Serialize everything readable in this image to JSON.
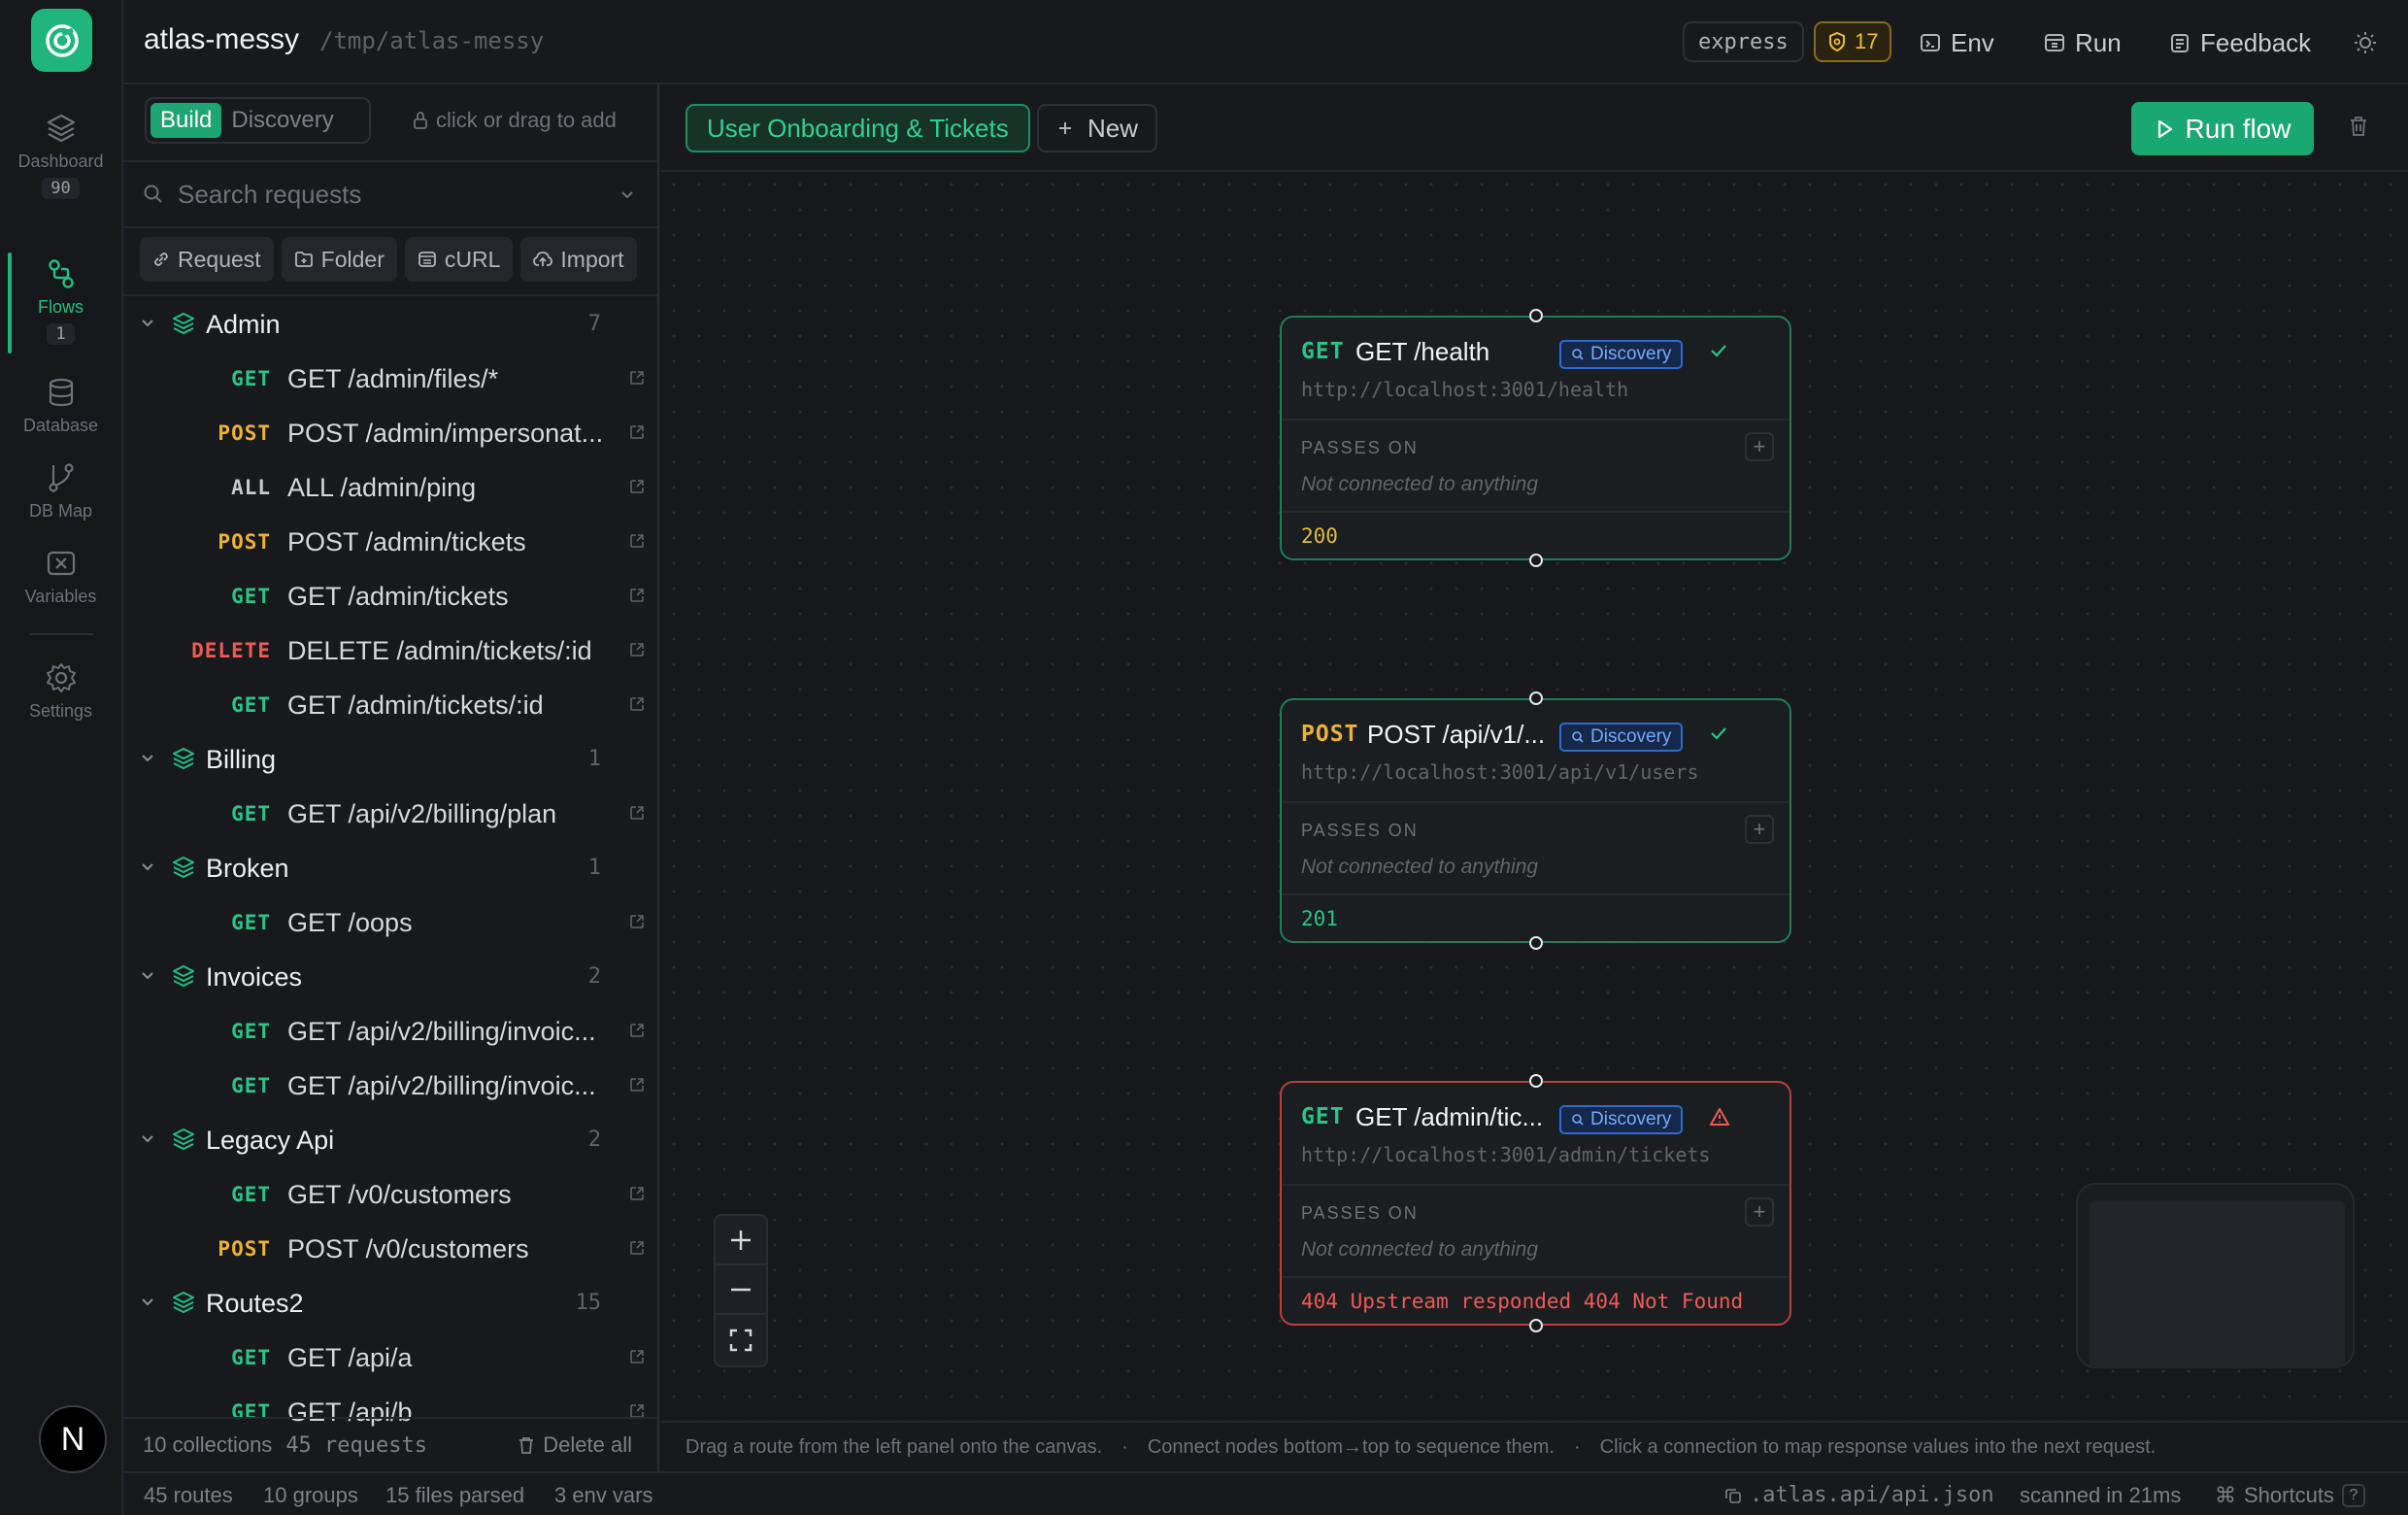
{
  "app": {
    "name": "atlas-messy",
    "path": "/tmp/atlas-messy",
    "framework": "express",
    "warning_count": "17",
    "env_label": "Env",
    "run_label": "Run",
    "feedback_label": "Feedback",
    "avatar_letter": "N",
    "accent": "#1fb57c"
  },
  "rail": {
    "items": [
      {
        "label": "Dashboard",
        "count": "90",
        "icon": "layers-icon"
      },
      {
        "label": "Flows",
        "count": "1",
        "icon": "flow-icon"
      },
      {
        "label": "Database",
        "icon": "database-icon"
      },
      {
        "label": "DB Map",
        "icon": "branch-icon"
      },
      {
        "label": "Variables",
        "icon": "variables-icon"
      },
      {
        "label": "Settings",
        "icon": "gear-icon"
      }
    ]
  },
  "sidebar": {
    "mode_build": "Build",
    "mode_discovery": "Discovery",
    "hint": "click or drag to add",
    "search_placeholder": "Search requests",
    "actions": {
      "request": "Request",
      "folder": "Folder",
      "curl": "cURL",
      "import": "Import"
    },
    "groups": [
      {
        "name": "Admin",
        "count": "7",
        "requests": [
          {
            "method": "GET",
            "name": "GET /admin/files/*"
          },
          {
            "method": "POST",
            "name": "POST /admin/impersonat..."
          },
          {
            "method": "ALL",
            "name": "ALL /admin/ping"
          },
          {
            "method": "POST",
            "name": "POST /admin/tickets"
          },
          {
            "method": "GET",
            "name": "GET /admin/tickets"
          },
          {
            "method": "DELETE",
            "name": "DELETE /admin/tickets/:id"
          },
          {
            "method": "GET",
            "name": "GET /admin/tickets/:id"
          }
        ]
      },
      {
        "name": "Billing",
        "count": "1",
        "requests": [
          {
            "method": "GET",
            "name": "GET /api/v2/billing/plan"
          }
        ]
      },
      {
        "name": "Broken",
        "count": "1",
        "requests": [
          {
            "method": "GET",
            "name": "GET /oops"
          }
        ]
      },
      {
        "name": "Invoices",
        "count": "2",
        "requests": [
          {
            "method": "GET",
            "name": "GET /api/v2/billing/invoic..."
          },
          {
            "method": "GET",
            "name": "GET /api/v2/billing/invoic..."
          }
        ]
      },
      {
        "name": "Legacy Api",
        "count": "2",
        "requests": [
          {
            "method": "GET",
            "name": "GET /v0/customers"
          },
          {
            "method": "POST",
            "name": "POST /v0/customers"
          }
        ]
      },
      {
        "name": "Routes2",
        "count": "15",
        "requests": [
          {
            "method": "GET",
            "name": "GET /api/a"
          },
          {
            "method": "GET",
            "name": "GET /api/b"
          }
        ]
      }
    ],
    "footer_collections": "10 collections",
    "footer_requests": "45 requests",
    "delete_all": "Delete all"
  },
  "canvas": {
    "flow_tab": "User Onboarding & Tickets",
    "new_tab": "New",
    "run_flow": "Run flow",
    "nodes": [
      {
        "method": "GET",
        "title": "GET /health",
        "badge": "Discovery",
        "status": "ok",
        "url": "http://localhost:3001/health",
        "passes_on": "PASSES ON",
        "empty": "Not connected to anything",
        "result": "200"
      },
      {
        "method": "POST",
        "title": "POST /api/v1/...",
        "badge": "Discovery",
        "status": "ok",
        "url": "http://localhost:3001/api/v1/users",
        "passes_on": "PASSES ON",
        "empty": "Not connected to anything",
        "result": "201"
      },
      {
        "method": "GET",
        "title": "GET /admin/tic...",
        "badge": "Discovery",
        "status": "error",
        "url": "http://localhost:3001/admin/tickets",
        "passes_on": "PASSES ON",
        "empty": "Not connected to anything",
        "result": "404 Upstream responded 404 Not Found"
      }
    ],
    "hints": [
      "Drag a route from the left panel onto the canvas.",
      "Connect nodes bottom→top to sequence them.",
      "Click a connection to map response values into the next request."
    ],
    "hint_separator": "·"
  },
  "statusbar": {
    "routes": "45 routes",
    "groups": "10 groups",
    "files": "15 files parsed",
    "env_vars": "3 env vars",
    "spec_file": ".atlas.api/api.json",
    "scan": "scanned in 21ms",
    "shortcuts": "Shortcuts",
    "help": "?"
  }
}
